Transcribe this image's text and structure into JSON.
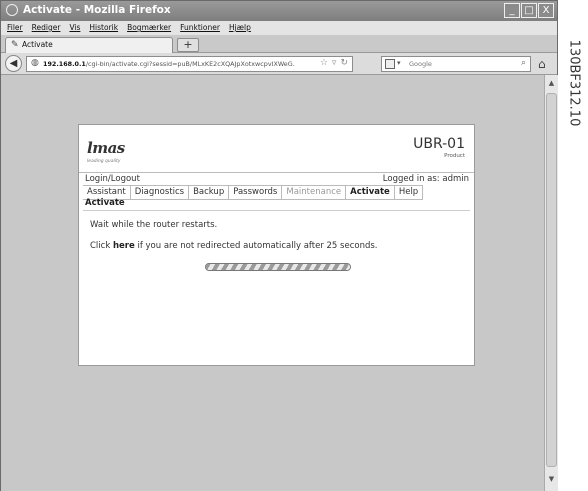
{
  "side_code": "130BF312.10",
  "window": {
    "title": "Activate - Mozilla Firefox",
    "buttons": [
      "_",
      "□",
      "X"
    ]
  },
  "menu": [
    "Filer",
    "Rediger",
    "Vis",
    "Historik",
    "Bogmærker",
    "Funktioner",
    "Hjælp"
  ],
  "tab": {
    "label": "Activate",
    "new_tab_symbol": "+"
  },
  "url": {
    "host": "192.168.0.1",
    "path": "/cgi-bin/activate.cgi?sessid=puB/MLxKE2cXQAJpXotxwcpvIXWeG."
  },
  "search": {
    "placeholder": "Google"
  },
  "page": {
    "logo_text": "lmas",
    "logo_tagline": "leading quality",
    "product_name": "UBR-01",
    "product_label": "Product",
    "login_link": "Login/Logout",
    "logged_in": "Logged in as: admin",
    "nav": [
      {
        "label": "Assistant",
        "state": "normal"
      },
      {
        "label": "Diagnostics",
        "state": "normal"
      },
      {
        "label": "Backup",
        "state": "normal"
      },
      {
        "label": "Passwords",
        "state": "normal"
      },
      {
        "label": "Maintenance",
        "state": "disabled"
      },
      {
        "label": "Activate",
        "state": "active"
      },
      {
        "label": "Help",
        "state": "normal"
      }
    ],
    "section_title": "Activate",
    "message_wait": "Wait while the router restarts.",
    "redirect_prefix": "Click",
    "redirect_link": "here",
    "redirect_suffix": "if you are not redirected automatically after 25 seconds.",
    "progress_fraction": 1.0
  },
  "icons": {
    "title": "firefox-icon",
    "back": "back-arrow-icon",
    "site": "site-identity-icon",
    "bookmark": "star-icon",
    "reload": "reload-icon",
    "search": "magnifier-icon",
    "home": "home-icon"
  }
}
